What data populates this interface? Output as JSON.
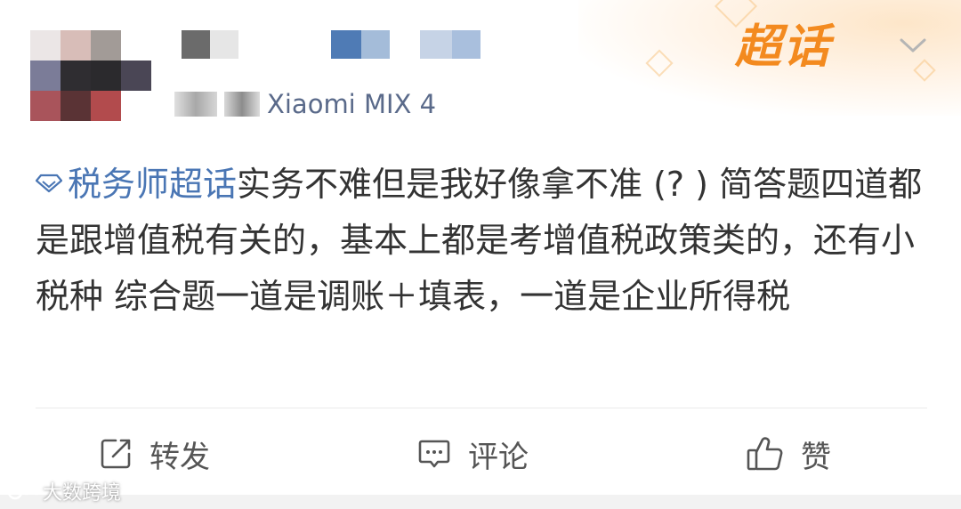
{
  "header": {
    "super_topic_badge": "超话",
    "meta_source": "Xiaomi MIX 4"
  },
  "post": {
    "topic": "税务师超话",
    "body": "实务不难但是我好像拿不准 (? ) 简答题四道都是跟增值税有关的，基本上都是考增值税政策类的，还有小税种 综合题一道是调账＋填表，一道是企业所得税"
  },
  "actions": {
    "repost_label": "转发",
    "comment_label": "评论",
    "like_label": "赞"
  },
  "watermark": {
    "text": "大数跨境"
  },
  "colors": {
    "topic": "#4a76b4",
    "meta": "#5a6a8a",
    "badge": "#f38a1f",
    "body_text": "#333333"
  }
}
